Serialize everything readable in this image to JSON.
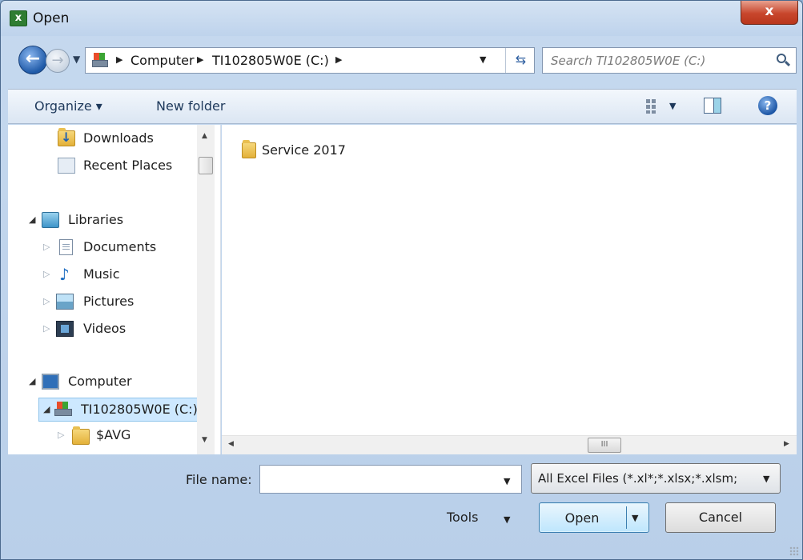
{
  "window": {
    "title": "Open",
    "app_icon": "excel-icon",
    "close_label": "x"
  },
  "navigation": {
    "back_icon": "back-arrow-icon",
    "forward_icon": "forward-arrow-icon",
    "breadcrumbs": [
      "Computer",
      "TI102805W0E (C:)"
    ],
    "refresh_icon": "refresh-icon"
  },
  "search": {
    "placeholder": "Search TI102805W0E (C:)"
  },
  "toolbar": {
    "organize_label": "Organize ▾",
    "new_folder_label": "New folder",
    "help_label": "?"
  },
  "nav_pane": {
    "downloads": "Downloads",
    "recent_places": "Recent Places",
    "libraries": "Libraries",
    "documents": "Documents",
    "music": "Music",
    "pictures": "Pictures",
    "videos": "Videos",
    "computer": "Computer",
    "drive_c": "TI102805W0E (C:)",
    "avg": "$AVG"
  },
  "files": [
    {
      "name": "Service 2017",
      "type": "folder"
    }
  ],
  "hscroll": {
    "thumb_label": "III"
  },
  "bottom": {
    "file_name_label": "File name:",
    "file_name_value": "",
    "filter_value": "All Excel Files (*.xl*;*.xlsx;*.xlsm;",
    "tools_label": "Tools",
    "open_label": "Open",
    "cancel_label": "Cancel"
  },
  "colors": {
    "chrome": "#c6d9ef",
    "selection": "#cde8ff",
    "close_button": "#c8462c"
  }
}
